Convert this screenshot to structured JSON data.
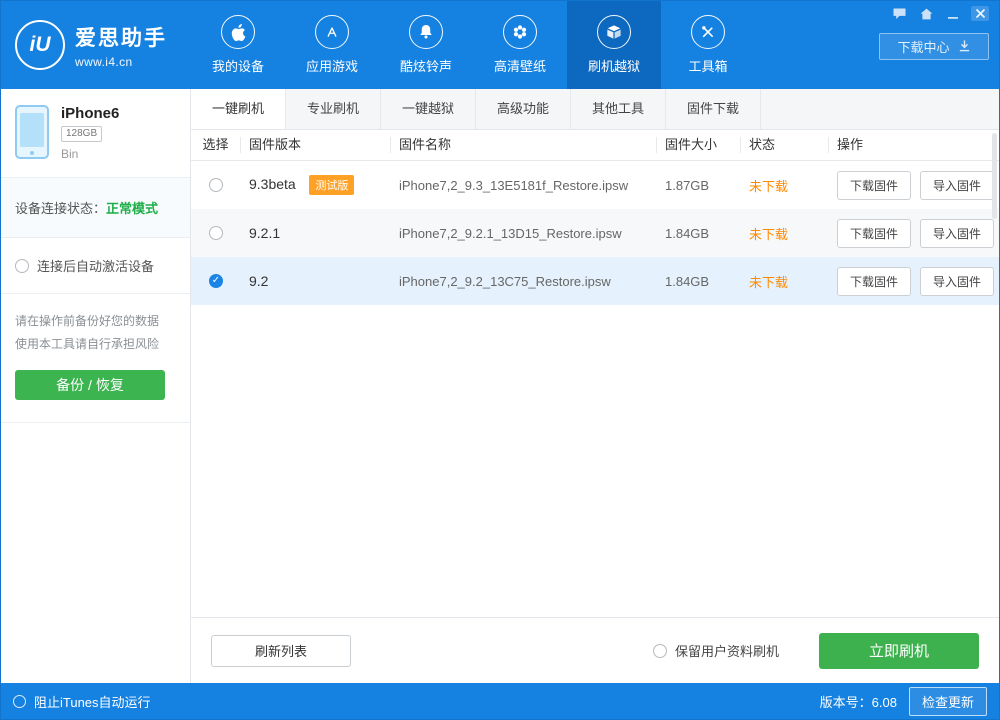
{
  "window": {
    "title": "爱思助手",
    "url": "www.i4.cn",
    "logo_text": "iU",
    "download_center_label": "下载中心"
  },
  "nav": {
    "items": [
      {
        "label": "我的设备",
        "icon": "apple-icon",
        "active": false
      },
      {
        "label": "应用游戏",
        "icon": "appstore-icon",
        "active": false
      },
      {
        "label": "酷炫铃声",
        "icon": "bell-icon",
        "active": false
      },
      {
        "label": "高清壁纸",
        "icon": "wallpaper-icon",
        "active": false
      },
      {
        "label": "刷机越狱",
        "icon": "package-icon",
        "active": true
      },
      {
        "label": "工具箱",
        "icon": "tools-icon",
        "active": false
      }
    ]
  },
  "sidebar": {
    "device": {
      "name": "iPhone6",
      "capacity": "128GB",
      "owner": "Bin"
    },
    "connection": {
      "label": "设备连接状态：",
      "status": "正常模式"
    },
    "auto_activate_label": "连接后自动激活设备",
    "warning": {
      "line1": "请在操作前备份好您的数据",
      "line2": "使用本工具请自行承担风险"
    },
    "backup_restore_label": "备份 / 恢复"
  },
  "tabs": {
    "items": [
      {
        "label": "一键刷机",
        "active": true
      },
      {
        "label": "专业刷机",
        "active": false
      },
      {
        "label": "一键越狱",
        "active": false
      },
      {
        "label": "高级功能",
        "active": false
      },
      {
        "label": "其他工具",
        "active": false
      },
      {
        "label": "固件下载",
        "active": false
      }
    ]
  },
  "table": {
    "headers": [
      "选择",
      "固件版本",
      "固件名称",
      "固件大小",
      "状态",
      "操作"
    ],
    "rows": [
      {
        "selected": false,
        "version": "9.3beta",
        "badge": "测试版",
        "filename": "iPhone7,2_9.3_13E5181f_Restore.ipsw",
        "size": "1.87GB",
        "status": "未下载",
        "actions": [
          "下载固件",
          "导入固件"
        ]
      },
      {
        "selected": false,
        "version": "9.2.1",
        "badge": "",
        "filename": "iPhone7,2_9.2.1_13D15_Restore.ipsw",
        "size": "1.84GB",
        "status": "未下载",
        "actions": [
          "下载固件",
          "导入固件"
        ]
      },
      {
        "selected": true,
        "version": "9.2",
        "badge": "",
        "filename": "iPhone7,2_9.2_13C75_Restore.ipsw",
        "size": "1.84GB",
        "status": "未下载",
        "actions": [
          "下载固件",
          "导入固件"
        ]
      }
    ],
    "selected_check": "✓"
  },
  "footer": {
    "refresh_label": "刷新列表",
    "keep_user_data_label": "保留用户资料刷机",
    "flash_now_label": "立即刷机"
  },
  "statusbar": {
    "block_itunes_label": "阻止iTunes自动运行",
    "version_label": "版本号：6.08",
    "check_update_label": "检查更新"
  },
  "icons": {
    "nav": [
      "apple",
      "appstore-a",
      "bell",
      "flower",
      "package",
      "crossed-tools"
    ],
    "window_controls": [
      "chat",
      "home",
      "minimize",
      "close"
    ],
    "download_center": "down-arrow"
  },
  "colors": {
    "topbar_blue": "#1581e0",
    "active_nav_blue": "#0d68bf",
    "green_button": "#3cb551",
    "green_status_text": "#1fae4a",
    "status_orange": "#ff8a00",
    "badge_orange": "#ffa126",
    "selected_row_bg": "#e5f1fc",
    "selected_radio_blue": "#1b84e7"
  }
}
